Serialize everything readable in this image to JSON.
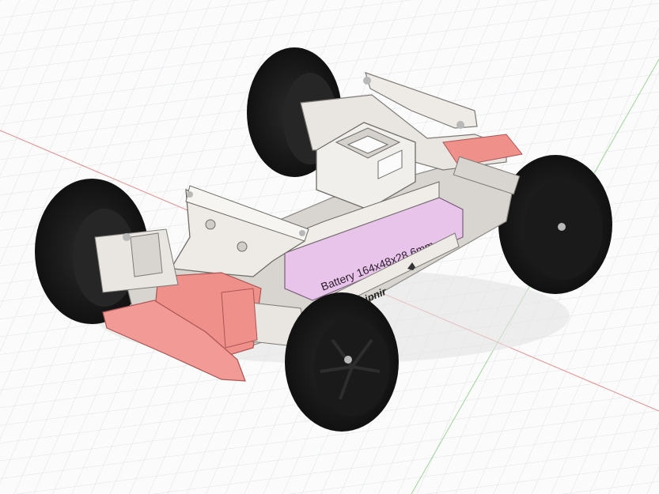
{
  "viewport": {
    "background": "#fbfbfb",
    "grid_color": "#dcdfe3",
    "x_axis_color": "#e58a8a",
    "y_axis_color": "#9fd49a"
  },
  "model": {
    "battery_label": "Battery 164x48x28.6mm",
    "brand_label": "Sleipnir",
    "colors": {
      "chassis": "#e9e6e2",
      "chassis_shadow": "#c9c5c0",
      "accent": "#f0908b",
      "accent_dark": "#c86a66",
      "battery": "#e8c3ea",
      "tire": "#1c1c1c",
      "screw": "#b8b8b8"
    },
    "icons": [
      "tire-icon",
      "wheel-rim-icon",
      "screw-icon",
      "horse-logo-icon"
    ]
  }
}
